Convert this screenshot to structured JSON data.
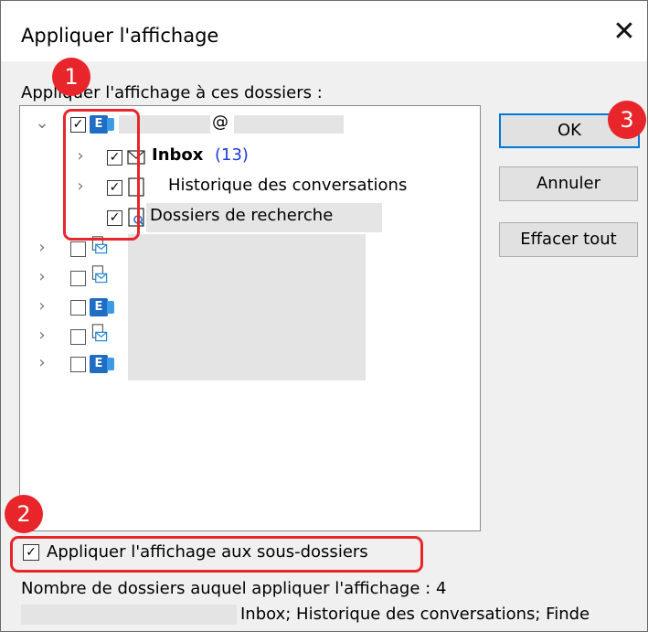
{
  "window": {
    "title": "Appliquer l'affichage",
    "close_glyph": "✕"
  },
  "folders_label": "Appliquer l'affichage à ces dossiers :",
  "tree": {
    "account": {
      "at_sign": "@",
      "expanded": true,
      "checked": true,
      "icon": "exchange-icon"
    },
    "children": [
      {
        "label": "Inbox",
        "count": "(13)",
        "checked": true,
        "icon": "mail-icon"
      },
      {
        "label": "Historique des conversations",
        "checked": true,
        "icon": "folder-icon"
      },
      {
        "label": "Dossiers de recherche",
        "checked": true,
        "icon": "search-folder-icon",
        "selected": true
      }
    ],
    "other_accounts": [
      {
        "icon": "mailbox-icon",
        "checked": false
      },
      {
        "icon": "mailbox-icon",
        "checked": false
      },
      {
        "icon": "exchange-icon",
        "checked": false
      },
      {
        "icon": "mailbox-icon",
        "checked": false
      },
      {
        "icon": "exchange-icon",
        "checked": false
      }
    ]
  },
  "buttons": {
    "ok": "OK",
    "cancel": "Annuler",
    "clear": "Effacer tout"
  },
  "subfolders": {
    "label": "Appliquer l'affichage aux sous-dossiers",
    "checked": true
  },
  "footer": {
    "count_label": "Nombre de dossiers auquel appliquer l'affichage : 4",
    "names": "Inbox; Historique des conversations; Finde"
  },
  "annotations": {
    "badge1": "1",
    "badge2": "2",
    "badge3": "3",
    "color": "#e8252b"
  }
}
